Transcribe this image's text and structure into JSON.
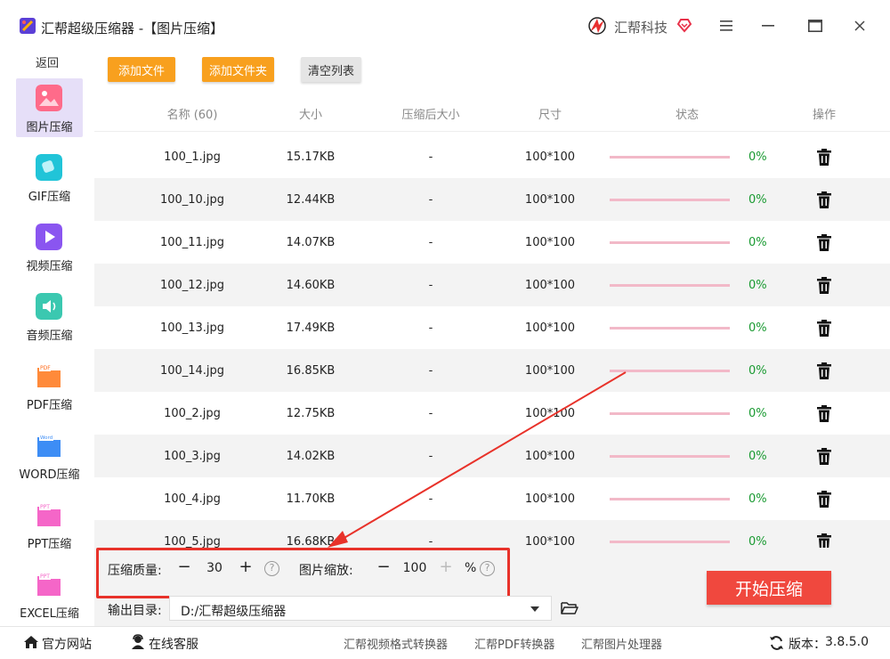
{
  "window": {
    "title": "汇帮超级压缩器 -【图片压缩】",
    "brand": "汇帮科技",
    "accent": "#f8a01e",
    "start_color": "#f0483e"
  },
  "sidebar": {
    "back_label": "返回",
    "items": [
      {
        "label": "图片压缩",
        "icon": "image-icon",
        "active": true
      },
      {
        "label": "GIF压缩",
        "icon": "gif-icon"
      },
      {
        "label": "视频压缩",
        "icon": "video-icon"
      },
      {
        "label": "音频压缩",
        "icon": "audio-icon"
      },
      {
        "label": "PDF压缩",
        "icon": "pdf-icon"
      },
      {
        "label": "WORD压缩",
        "icon": "word-icon"
      },
      {
        "label": "PPT压缩",
        "icon": "ppt-icon"
      },
      {
        "label": "EXCEL压缩",
        "icon": "excel-icon"
      }
    ]
  },
  "toolbar": {
    "add_file": "添加文件",
    "add_folder": "添加文件夹",
    "clear_list": "清空列表"
  },
  "table": {
    "headers": {
      "name": "名称 (60)",
      "size": "大小",
      "compressed_size": "压缩后大小",
      "dimensions": "尺寸",
      "status": "状态",
      "action": "操作"
    },
    "rows": [
      {
        "name": "100_1.jpg",
        "size": "15.17KB",
        "compressed": "-",
        "dim": "100*100",
        "progress": "0%"
      },
      {
        "name": "100_10.jpg",
        "size": "12.44KB",
        "compressed": "-",
        "dim": "100*100",
        "progress": "0%"
      },
      {
        "name": "100_11.jpg",
        "size": "14.07KB",
        "compressed": "-",
        "dim": "100*100",
        "progress": "0%"
      },
      {
        "name": "100_12.jpg",
        "size": "14.60KB",
        "compressed": "-",
        "dim": "100*100",
        "progress": "0%"
      },
      {
        "name": "100_13.jpg",
        "size": "17.49KB",
        "compressed": "-",
        "dim": "100*100",
        "progress": "0%"
      },
      {
        "name": "100_14.jpg",
        "size": "16.85KB",
        "compressed": "-",
        "dim": "100*100",
        "progress": "0%"
      },
      {
        "name": "100_2.jpg",
        "size": "12.75KB",
        "compressed": "-",
        "dim": "100*100",
        "progress": "0%"
      },
      {
        "name": "100_3.jpg",
        "size": "14.02KB",
        "compressed": "-",
        "dim": "100*100",
        "progress": "0%"
      },
      {
        "name": "100_4.jpg",
        "size": "11.70KB",
        "compressed": "-",
        "dim": "100*100",
        "progress": "0%"
      },
      {
        "name": "100_5.jpg",
        "size": "16.68KB",
        "compressed": "-",
        "dim": "100*100",
        "progress": "0%"
      }
    ]
  },
  "settings": {
    "quality_label": "压缩质量:",
    "quality_value": "30",
    "scale_label": "图片缩放:",
    "scale_value": "100",
    "scale_unit": "%",
    "output_label": "输出目录:",
    "output_value": "D:/汇帮超级压缩器",
    "start_label": "开始压缩"
  },
  "statusbar": {
    "website": "官方网站",
    "support": "在线客服",
    "link1": "汇帮视频格式转换器",
    "link2": "汇帮PDF转换器",
    "link3": "汇帮图片处理器",
    "version_label": "版本：",
    "version": "3.8.5.0"
  }
}
